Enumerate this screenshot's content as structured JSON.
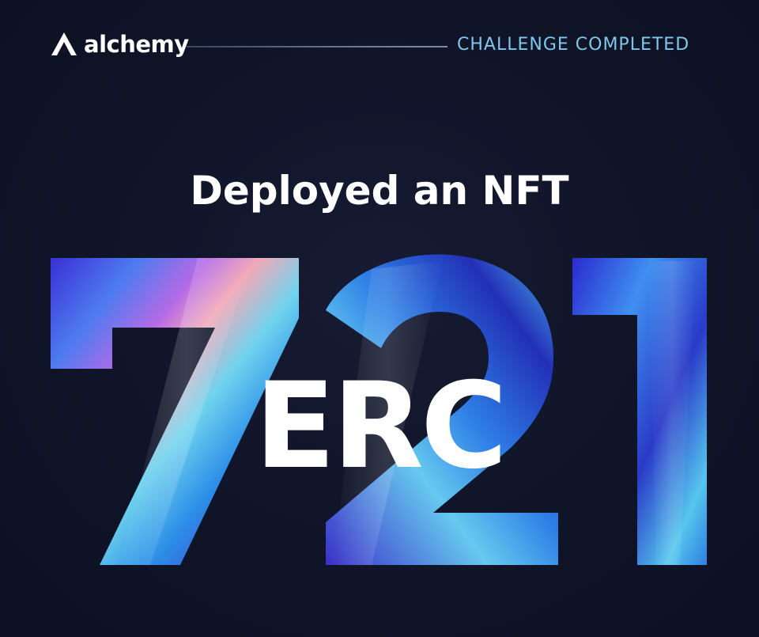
{
  "brand": {
    "name": "alchemy",
    "logo_icon": "alchemy-triangle-logo",
    "status": "CHALLENGE COMPLETED"
  },
  "headline": "Deployed an NFT",
  "standard": {
    "prefix": "ERC",
    "number": "721"
  },
  "colors": {
    "background": "#0f1326",
    "status_text": "#7fc7e8",
    "headline_text": "#ffffff",
    "gradient_stops": [
      "#3a2fd6",
      "#2d8fe8",
      "#6fd3ee",
      "#b56ae6",
      "#f3a9b8"
    ]
  }
}
